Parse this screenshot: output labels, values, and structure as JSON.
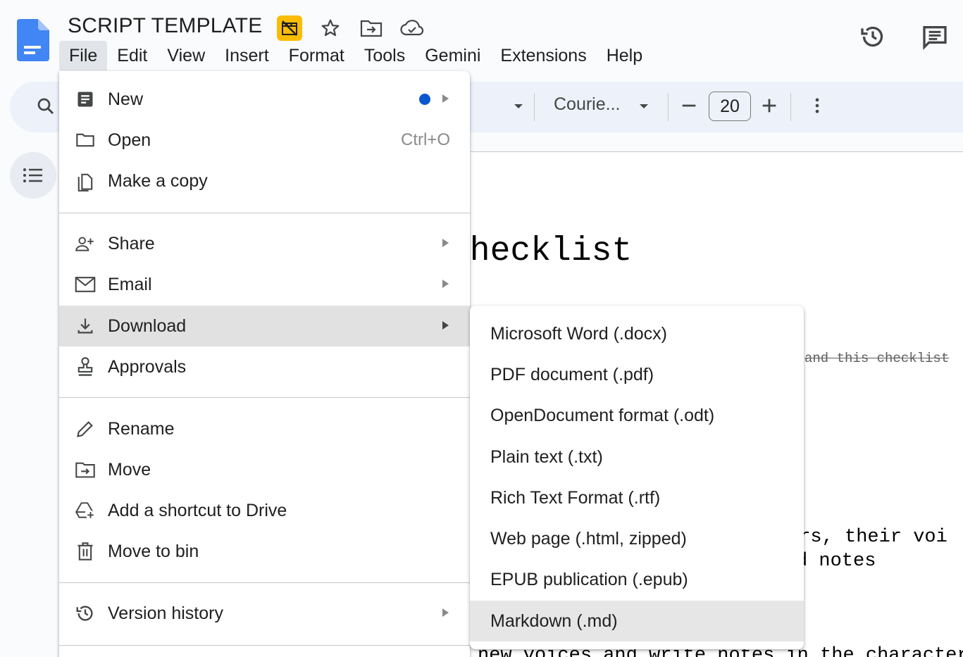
{
  "header": {
    "title": "SCRIPT TEMPLATE",
    "menus": [
      "File",
      "Edit",
      "View",
      "Insert",
      "Format",
      "Tools",
      "Gemini",
      "Extensions",
      "Help"
    ],
    "active_menu": "File",
    "accent_color": "#0b57d0"
  },
  "toolbar": {
    "font_name": "Courie...",
    "font_size": "20"
  },
  "document": {
    "heading_fragment": "Checklist",
    "strike_fragment": "and this checklist",
    "line1_fragment": "ers, their voi",
    "line2_fragment": "d notes",
    "line3_fragment": "new voices and write notes in the character"
  },
  "file_menu": {
    "items": [
      {
        "label": "New",
        "icon": "new-doc-icon",
        "submenu": true,
        "dot": true
      },
      {
        "label": "Open",
        "icon": "folder-icon",
        "shortcut": "Ctrl+O"
      },
      {
        "label": "Make a copy",
        "icon": "copy-icon"
      },
      {
        "label": "Share",
        "icon": "share-person-icon",
        "submenu": true
      },
      {
        "label": "Email",
        "icon": "email-icon",
        "submenu": true
      },
      {
        "label": "Download",
        "icon": "download-icon",
        "submenu": true,
        "highlighted": true
      },
      {
        "label": "Approvals",
        "icon": "approval-stamp-icon"
      },
      {
        "label": "Rename",
        "icon": "pencil-icon"
      },
      {
        "label": "Move",
        "icon": "move-folder-icon"
      },
      {
        "label": "Add a shortcut to Drive",
        "icon": "drive-shortcut-icon"
      },
      {
        "label": "Move to bin",
        "icon": "trash-icon"
      },
      {
        "label": "Version history",
        "icon": "history-icon",
        "submenu": true
      }
    ]
  },
  "download_submenu": {
    "items": [
      {
        "label": "Microsoft Word (.docx)"
      },
      {
        "label": "PDF document (.pdf)"
      },
      {
        "label": "OpenDocument format (.odt)"
      },
      {
        "label": "Plain text (.txt)"
      },
      {
        "label": "Rich Text Format (.rtf)"
      },
      {
        "label": "Web page (.html, zipped)"
      },
      {
        "label": "EPUB publication (.epub)"
      },
      {
        "label": "Markdown (.md)",
        "highlighted": true
      }
    ]
  }
}
